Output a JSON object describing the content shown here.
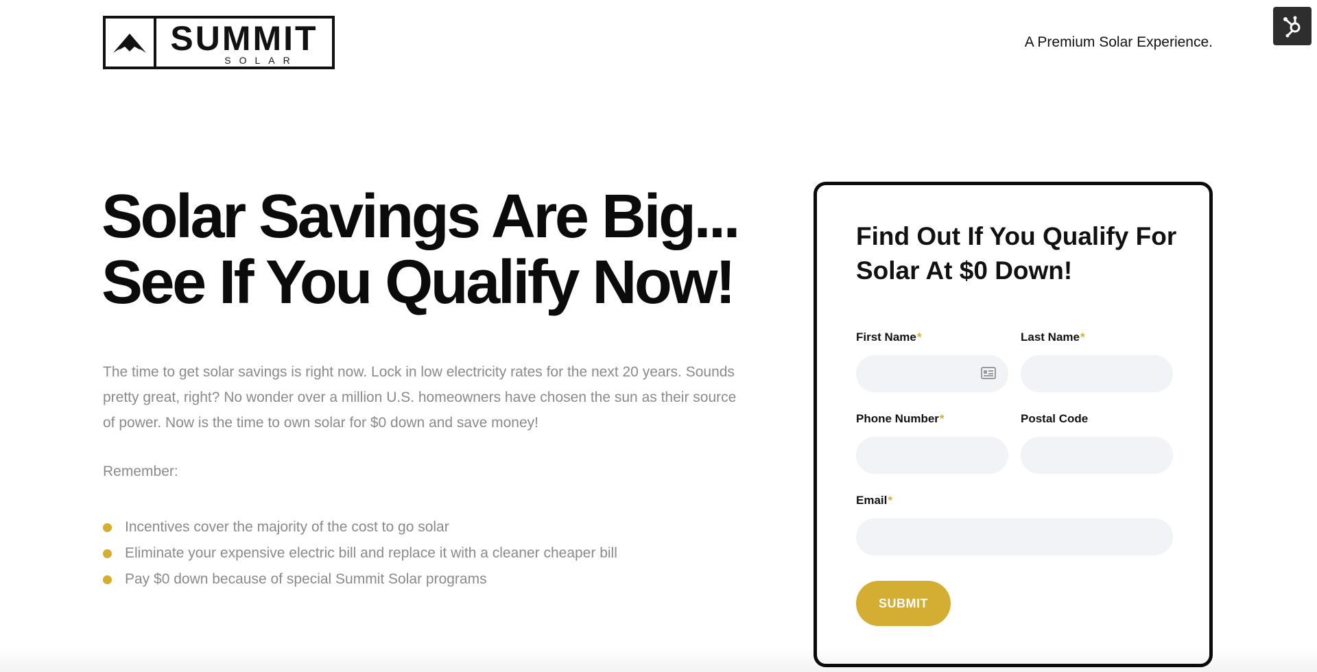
{
  "header": {
    "logo_word": "SUMMIT",
    "logo_sub": "SOLAR",
    "tagline": "A Premium Solar Experience."
  },
  "hero": {
    "title_line1": "Solar Savings Are Big...",
    "title_line2": "See If You Qualify Now!",
    "body": "The time to get solar savings is right now.  Lock in low electricity rates for the next 20 years. Sounds pretty great, right? No wonder over a million U.S. homeowners have chosen the sun as their source of power. Now is the time to own solar for $0 down and save money!",
    "remember": "Remember:",
    "bullets": [
      "Incentives cover the majority of the cost to go solar",
      "Eliminate your expensive electric bill and replace it with a cleaner cheaper bill",
      "Pay $0 down because of special Summit Solar programs"
    ]
  },
  "form": {
    "title": "Find Out If You Qualify For Solar At $0 Down!",
    "required_mark": "*",
    "fields": {
      "first_name": {
        "label": "First Name",
        "value": "",
        "placeholder": ""
      },
      "last_name": {
        "label": "Last Name",
        "value": "",
        "placeholder": ""
      },
      "phone": {
        "label": "Phone Number",
        "value": "",
        "placeholder": ""
      },
      "postal": {
        "label": "Postal Code",
        "value": "",
        "placeholder": ""
      },
      "email": {
        "label": "Email",
        "value": "",
        "placeholder": ""
      }
    },
    "submit_label": "SUBMIT"
  },
  "icons": {
    "logo_mark": "mountain-peak-icon",
    "hub_badge": "hubspot-sprocket-icon",
    "autofill": "contact-card-icon"
  },
  "colors": {
    "accent": "#d4ae33",
    "text_dark": "#111111",
    "text_muted": "#8a8a8a",
    "input_bg": "#f2f3f6",
    "badge_bg": "#2e2e2e"
  }
}
